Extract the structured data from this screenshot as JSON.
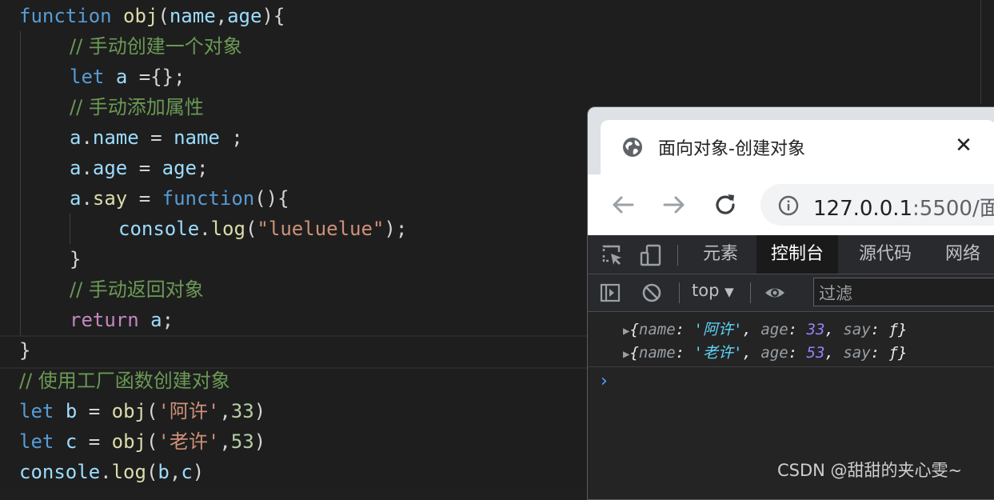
{
  "editor": {
    "line1": {
      "kw": "function",
      "name": "obj",
      "p1": "name",
      "p2": "age"
    },
    "line2": {
      "comment": "// 手动创建一个对象"
    },
    "line3": {
      "kw": "let",
      "var": "a",
      "rest": " ={};"
    },
    "line4": {
      "comment": "// 手动添加属性"
    },
    "line5": {
      "obj": "a",
      "prop": "name",
      "val": "name",
      "end": " ;"
    },
    "line6": {
      "obj": "a",
      "prop": "age",
      "val": "age",
      "end": ";"
    },
    "line7": {
      "obj": "a",
      "prop": "say",
      "kw": "function",
      "end": "(){"
    },
    "line8": {
      "obj": "console",
      "fn": "log",
      "str": "\"lueluelue\"",
      "end": ");"
    },
    "line9": {
      "text": "}"
    },
    "line10": {
      "comment": "// 手动返回对象"
    },
    "line11": {
      "kw": "return",
      "var": "a",
      "end": ";"
    },
    "line12": {
      "text": "}"
    },
    "line13": {
      "comment": "// 使用工厂函数创建对象"
    },
    "line14": {
      "kw": "let",
      "var": "b",
      "fn": "obj",
      "str": "'阿许'",
      "num": "33"
    },
    "line15": {
      "kw": "let",
      "var": "c",
      "fn": "obj",
      "str": "'老许'",
      "num": "53"
    },
    "line16": {
      "obj": "console",
      "fn": "log",
      "a1": "b",
      "a2": "c"
    }
  },
  "browser": {
    "tab_title": "面向对象-创建对象",
    "close_glyph": "✕",
    "url_host": "127.0.0.1",
    "url_path": ":5500/面"
  },
  "devtools": {
    "tabs": [
      "元素",
      "控制台",
      "源代码",
      "网络"
    ],
    "active_tab": "控制台",
    "context": "top",
    "filter_placeholder": "过滤",
    "logs": [
      {
        "name": "'阿许'",
        "age": "33",
        "say": "ƒ"
      },
      {
        "name": "'老许'",
        "age": "53",
        "say": "ƒ"
      }
    ],
    "prompt": "›"
  },
  "watermark": "CSDN @甜甜的夹心雯~",
  "icons": [
    "globe-icon",
    "close-icon",
    "back-arrow-icon",
    "forward-arrow-icon",
    "reload-icon",
    "info-icon",
    "inspect-element-icon",
    "device-toolbar-icon",
    "sidebar-toggle-icon",
    "clear-console-icon",
    "dropdown-arrow-icon",
    "eye-icon",
    "expand-triangle-icon"
  ],
  "colors": {
    "editor_bg": "#1e1e1e",
    "keyword": "#569cd6",
    "function_name": "#dcdcaa",
    "variable": "#9cdcfe",
    "string": "#ce9178",
    "number": "#b5cea8",
    "comment": "#6a9955",
    "return_keyword": "#c586c0",
    "console_string": "#5cd5fb",
    "console_number": "#9980ff"
  }
}
